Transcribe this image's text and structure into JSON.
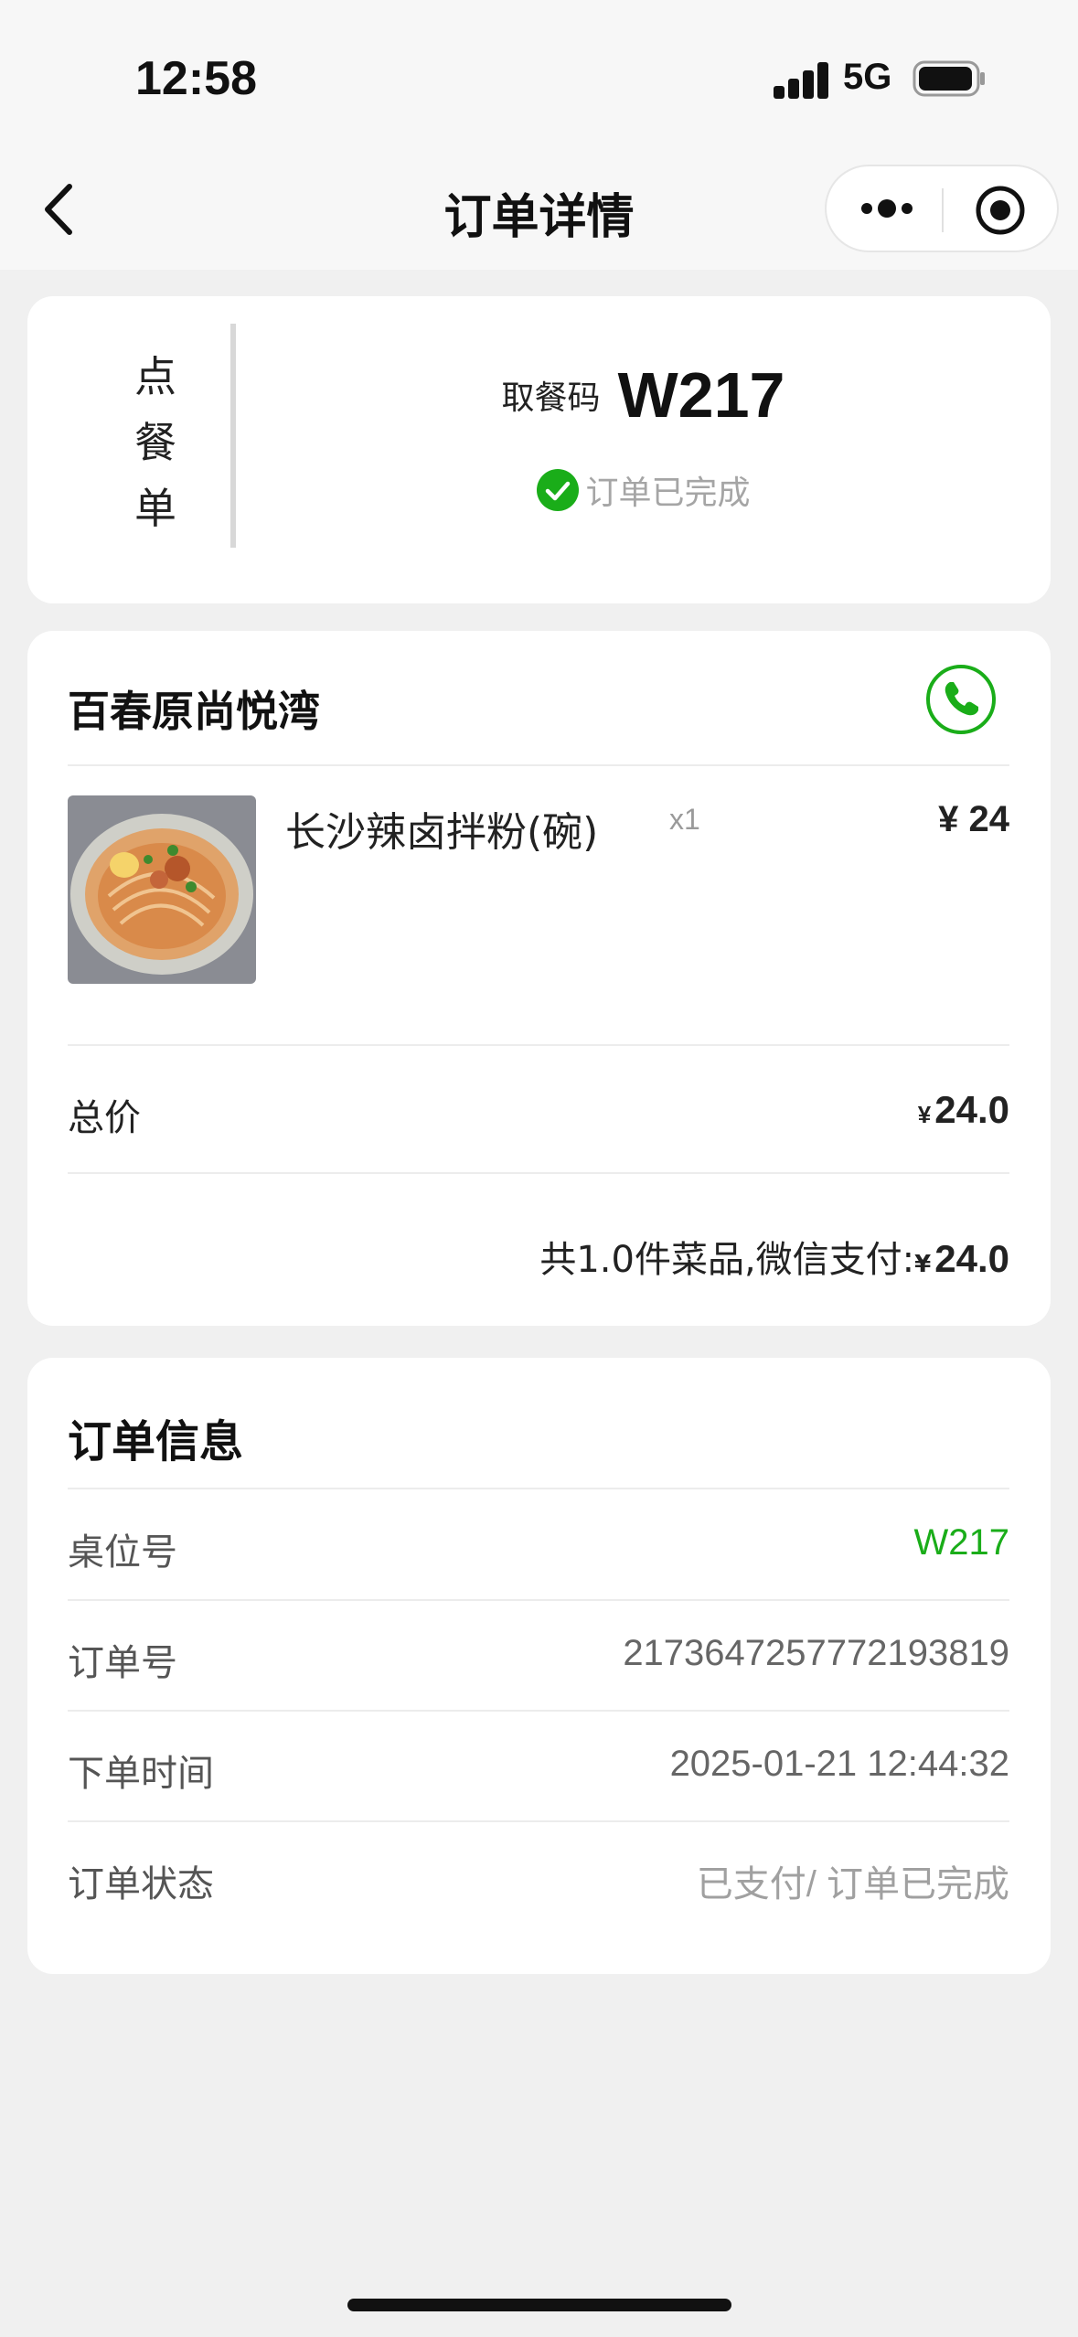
{
  "status_bar": {
    "time": "12:58",
    "network": "5G",
    "icons": [
      "signal-icon",
      "battery-icon"
    ]
  },
  "nav": {
    "title": "订单详情",
    "back_icon": "back-arrow-icon",
    "more_icon": "more-dots-icon",
    "close_icon": "target-circle-icon"
  },
  "order_card": {
    "type_label": [
      "点",
      "餐",
      "单"
    ],
    "pickup_label": "取餐码",
    "pickup_code": "W217",
    "status_icon": "check-circle-icon",
    "status_text": "订单已完成"
  },
  "store": {
    "name": "百春原尚悦湾",
    "phone_icon": "phone-icon",
    "items": [
      {
        "name": "长沙辣卤拌粉(碗)",
        "qty": "x1",
        "price": "¥ 24",
        "image": "noodle-bowl-image"
      }
    ],
    "total_label": "总价",
    "total_currency": "¥",
    "total_value": "24.0",
    "summary_text": "共1.0件菜品,微信支付:",
    "summary_currency": "¥",
    "summary_value": "24.0"
  },
  "order_info": {
    "title": "订单信息",
    "rows": [
      {
        "key": "桌位号",
        "value": "W217"
      },
      {
        "key": "订单号",
        "value": "2173647257772193819"
      },
      {
        "key": "下单时间",
        "value": "2025-01-21 12:44:32"
      },
      {
        "key": "订单状态",
        "value": "已支付/ 订单已完成"
      }
    ]
  },
  "colors": {
    "accent_green": "#1aad19",
    "background": "#f0f0f0",
    "card": "#ffffff"
  }
}
